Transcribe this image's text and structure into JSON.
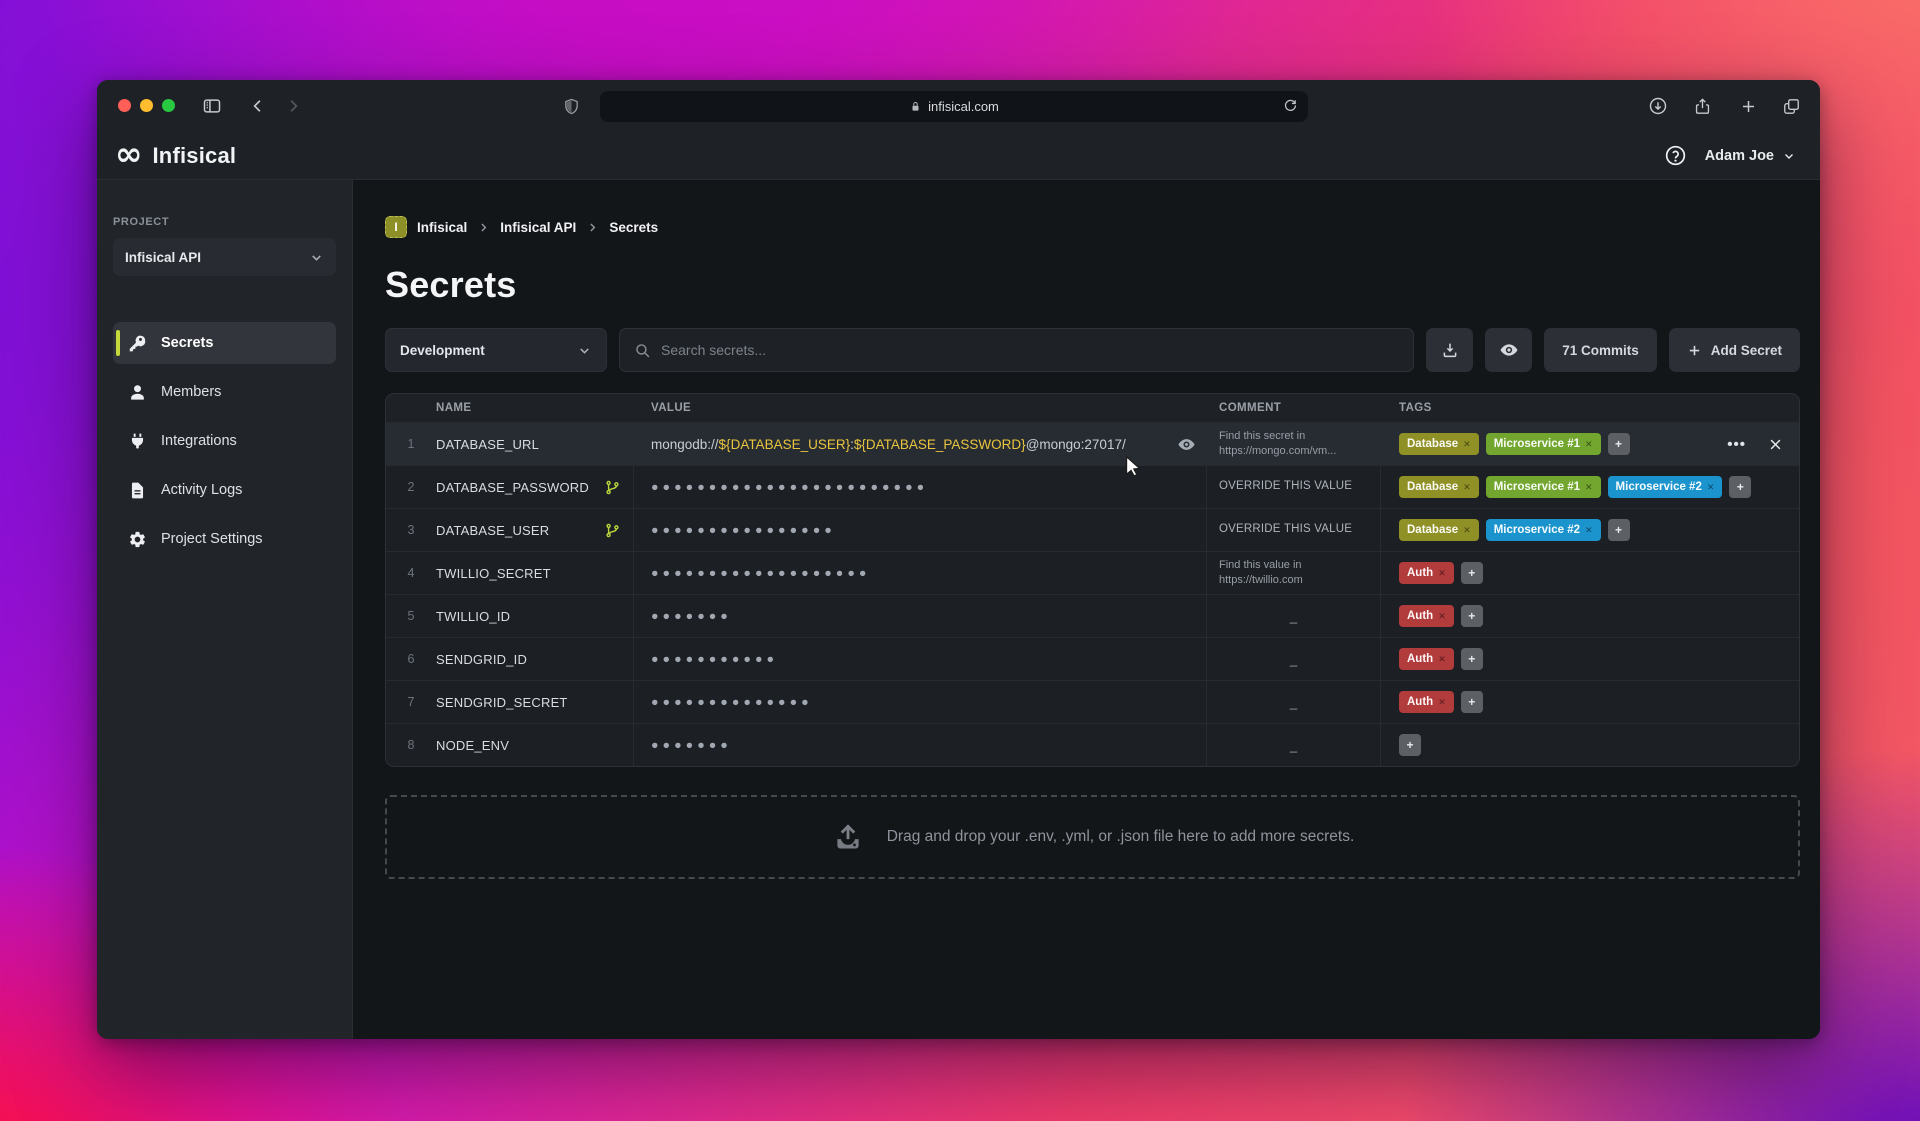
{
  "browser": {
    "url": "infisical.com",
    "controls": [
      "close",
      "minimize",
      "zoom"
    ]
  },
  "header": {
    "logo_text": "Infisical",
    "user_name": "Adam Joe"
  },
  "sidebar": {
    "project_label": "PROJECT",
    "project_selected": "Infisical API",
    "items": [
      {
        "label": "Secrets",
        "icon": "key-icon",
        "active": true
      },
      {
        "label": "Members",
        "icon": "person-icon",
        "active": false
      },
      {
        "label": "Integrations",
        "icon": "plug-icon",
        "active": false
      },
      {
        "label": "Activity Logs",
        "icon": "document-icon",
        "active": false
      },
      {
        "label": "Project Settings",
        "icon": "gear-icon",
        "active": false
      }
    ]
  },
  "breadcrumb": {
    "badge": "I",
    "items": [
      "Infisical",
      "Infisical API",
      "Secrets"
    ]
  },
  "page": {
    "title": "Secrets"
  },
  "toolbar": {
    "environment": "Development",
    "search_placeholder": "Search secrets...",
    "commits_label": "71 Commits",
    "add_secret_label": "Add Secret"
  },
  "table": {
    "columns": [
      "NAME",
      "VALUE",
      "COMMENT",
      "TAGS"
    ],
    "rows": [
      {
        "num": "1",
        "name": "DATABASE_URL",
        "branched": false,
        "highlighted": true,
        "show_eye": true,
        "show_actions": true,
        "value_parts": [
          {
            "text": "mongodb://",
            "highlight": false
          },
          {
            "text": "${DATABASE_USER}",
            "highlight": true
          },
          {
            "text": ":",
            "highlight": false
          },
          {
            "text": "${DATABASE_PASSWORD}",
            "highlight": true
          },
          {
            "text": "@mongo:27017/",
            "highlight": false
          }
        ],
        "comment": "Find this secret in https://mongo.com/vm...",
        "comment_style": "text",
        "tags": [
          {
            "label": "Database",
            "color": "olive"
          },
          {
            "label": "Microservice #1",
            "color": "green"
          }
        ],
        "has_add_tag": true
      },
      {
        "num": "2",
        "name": "DATABASE_PASSWORD",
        "branched": true,
        "dots": 24,
        "comment": "OVERRIDE THIS VALUE",
        "comment_style": "override",
        "tags": [
          {
            "label": "Database",
            "color": "olive"
          },
          {
            "label": "Microservice #1",
            "color": "green"
          },
          {
            "label": "Microservice #2",
            "color": "blue"
          }
        ],
        "has_add_tag": true
      },
      {
        "num": "3",
        "name": "DATABASE_USER",
        "branched": true,
        "dots": 16,
        "comment": "OVERRIDE THIS VALUE",
        "comment_style": "override",
        "tags": [
          {
            "label": "Database",
            "color": "olive"
          },
          {
            "label": "Microservice #2",
            "color": "blue"
          }
        ],
        "has_add_tag": true
      },
      {
        "num": "4",
        "name": "TWILLIO_SECRET",
        "branched": false,
        "dots": 19,
        "comment": "Find this value in https://twillio.com",
        "comment_style": "text",
        "tags": [
          {
            "label": "Auth",
            "color": "red"
          }
        ],
        "has_add_tag": true
      },
      {
        "num": "5",
        "name": "TWILLIO_ID",
        "branched": false,
        "dots": 7,
        "comment": "_",
        "comment_style": "dash",
        "tags": [
          {
            "label": "Auth",
            "color": "red"
          }
        ],
        "has_add_tag": true
      },
      {
        "num": "6",
        "name": "SENDGRID_ID",
        "branched": false,
        "dots": 11,
        "comment": "_",
        "comment_style": "dash",
        "tags": [
          {
            "label": "Auth",
            "color": "red"
          }
        ],
        "has_add_tag": true
      },
      {
        "num": "7",
        "name": "SENDGRID_SECRET",
        "branched": false,
        "dots": 14,
        "comment": "_",
        "comment_style": "dash",
        "tags": [
          {
            "label": "Auth",
            "color": "red"
          }
        ],
        "has_add_tag": true
      },
      {
        "num": "8",
        "name": "NODE_ENV",
        "branched": false,
        "dots": 7,
        "comment": "_",
        "comment_style": "dash",
        "tags": [],
        "has_add_tag": true
      }
    ]
  },
  "dropzone": {
    "text": "Drag and drop your .env, .yml, or .json file here to add more secrets."
  },
  "colors": {
    "accent": "#c5da3a",
    "value_highlight": "#e9c53e",
    "tags": {
      "olive": "#8f9026",
      "green": "#72a62e",
      "blue": "#1b94ce",
      "red": "#b23b3b"
    }
  }
}
